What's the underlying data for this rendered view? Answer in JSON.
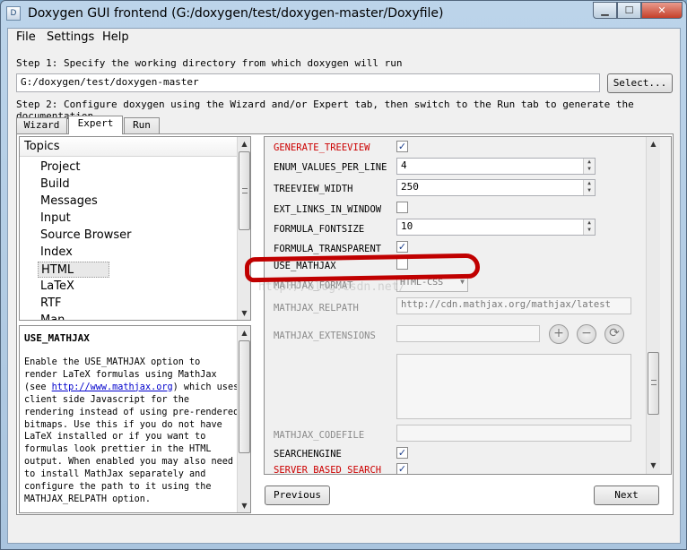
{
  "window": {
    "title": "Doxygen GUI frontend (G:/doxygen/test/doxygen-master/Doxyfile)",
    "controls": [
      "minimize",
      "maximize",
      "close"
    ]
  },
  "menu": [
    "File",
    "Settings",
    "Help"
  ],
  "step1": {
    "label": "Step 1: Specify the working directory from which doxygen will run",
    "directory": "G:/doxygen/test/doxygen-master",
    "select_button": "Select..."
  },
  "step2": {
    "label": "Step 2: Configure doxygen using the Wizard and/or Expert tab, then switch to the Run tab to generate the documentation"
  },
  "tabs": [
    {
      "label": "Wizard",
      "active": false
    },
    {
      "label": "Expert",
      "active": true
    },
    {
      "label": "Run",
      "active": false
    }
  ],
  "topics": {
    "header": "Topics",
    "items": [
      "Project",
      "Build",
      "Messages",
      "Input",
      "Source Browser",
      "Index",
      "HTML",
      "LaTeX",
      "RTF",
      "Man"
    ],
    "selected": "HTML"
  },
  "help": {
    "title": "USE_MATHJAX",
    "line1": "Enable the USE_MATHJAX option to",
    "line2": "render LaTeX formulas using MathJax",
    "line3_pre": "(see ",
    "line3_link": "http://www.mathjax.org",
    "line3_post": ") which uses",
    "rest": "client side Javascript for the\nrendering instead of using pre-rendered\nbitmaps. Use this if you do not have\nLaTeX installed or if you want to\nformulas look prettier in the HTML\noutput. When enabled you may also need\nto install MathJax separately and\nconfigure the path to it using the\nMATHJAX_RELPATH option."
  },
  "options": {
    "generate_treeview": {
      "label": "GENERATE_TREEVIEW",
      "checked": true
    },
    "enum_values_per_line": {
      "label": "ENUM_VALUES_PER_LINE",
      "value": "4"
    },
    "treeview_width": {
      "label": "TREEVIEW_WIDTH",
      "value": "250"
    },
    "ext_links_in_window": {
      "label": "EXT_LINKS_IN_WINDOW",
      "checked": false
    },
    "formula_fontsize": {
      "label": "FORMULA_FONTSIZE",
      "value": "10"
    },
    "formula_transparent": {
      "label": "FORMULA_TRANSPARENT",
      "checked": true
    },
    "use_mathjax": {
      "label": "USE_MATHJAX",
      "checked": false
    },
    "mathjax_format": {
      "label": "MATHJAX_FORMAT",
      "value": "HTML-CSS"
    },
    "mathjax_relpath": {
      "label": "MATHJAX_RELPATH",
      "value": "http://cdn.mathjax.org/mathjax/latest"
    },
    "mathjax_extensions": {
      "label": "MATHJAX_EXTENSIONS",
      "value": ""
    },
    "mathjax_codefile": {
      "label": "MATHJAX_CODEFILE",
      "value": ""
    },
    "searchengine": {
      "label": "SEARCHENGINE",
      "checked": true
    },
    "server_based_search": {
      "label": "SERVER_BASED_SEARCH",
      "checked": true
    }
  },
  "list_buttons": {
    "add": "+",
    "remove": "−",
    "update": "⟳"
  },
  "nav": {
    "previous": "Previous",
    "next": "Next"
  },
  "watermark": "http://blog.csdn.net/",
  "colors": {
    "modified_option": "#cc0000",
    "annotation_circle": "#c00000"
  }
}
